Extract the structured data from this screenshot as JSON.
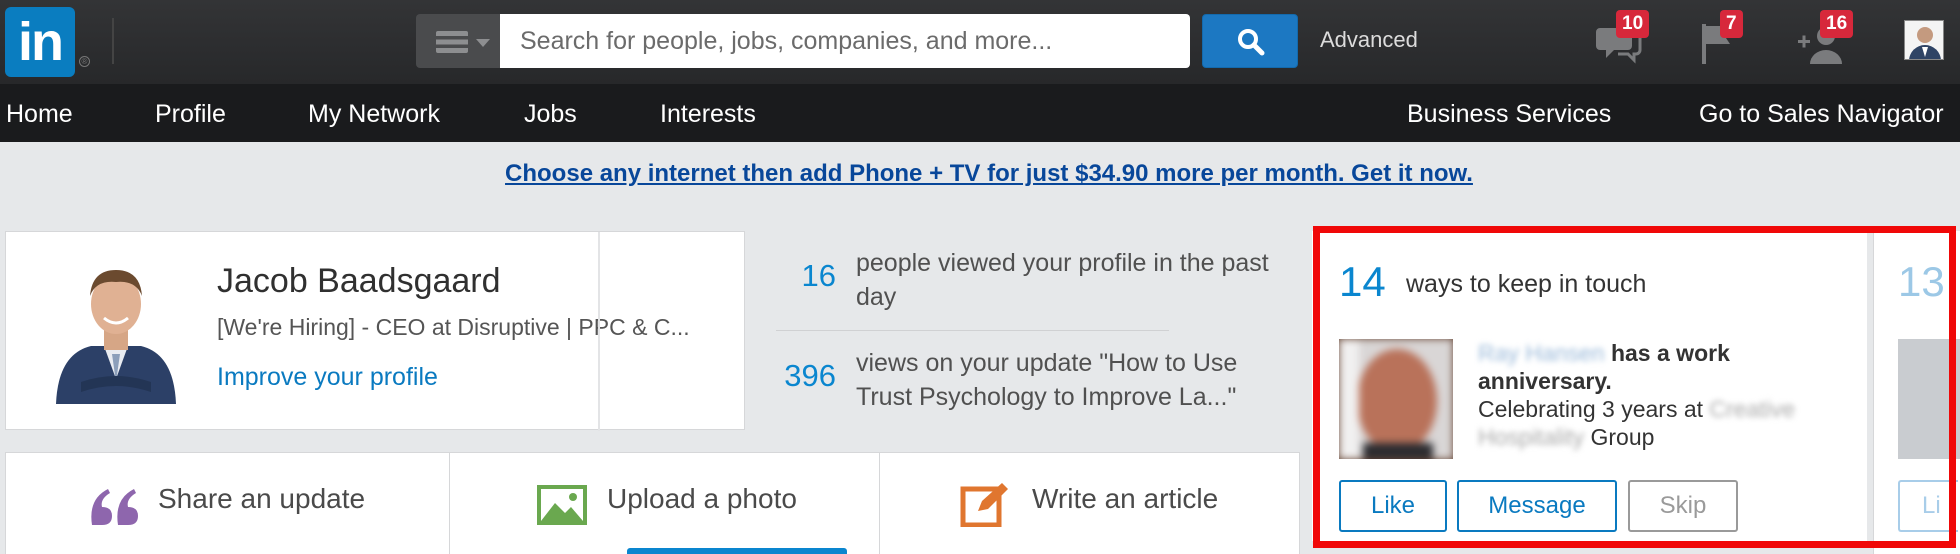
{
  "header": {
    "logo_text": "in",
    "logo_reg": "®",
    "search_placeholder": "Search for people, jobs, companies, and more...",
    "advanced_label": "Advanced",
    "messages_badge": "10",
    "notifications_badge": "7",
    "connections_badge": "16"
  },
  "nav": {
    "items": [
      "Home",
      "Profile",
      "My Network",
      "Jobs",
      "Interests"
    ],
    "business_services": "Business Services",
    "sales_navigator": "Go to Sales Navigator"
  },
  "ad": {
    "text": "Choose any internet then add Phone + TV for just $34.90 more per month. Get it now."
  },
  "profile": {
    "name": "Jacob Baadsgaard",
    "headline": "[We're Hiring] - CEO at Disruptive | PPC & C...",
    "improve_link": "Improve your profile",
    "stats": [
      {
        "count": "16",
        "text": "people viewed your profile in the past day"
      },
      {
        "count": "396",
        "text": "views on your update \"How to Use Trust Psychology to Improve La...\""
      }
    ]
  },
  "actions": {
    "share": "Share an update",
    "upload": "Upload a photo",
    "write": "Write an article"
  },
  "keep_in_touch": {
    "count": "14",
    "title": "ways to keep in touch",
    "blurred_name": "Ray Hansen",
    "event_text": "has a work anniversary.",
    "celebrating_prefix": "Celebrating 3 years at",
    "blurred_company": "Creative Hospitality",
    "company_suffix": "Group",
    "like": "Like",
    "message": "Message",
    "skip": "Skip"
  },
  "next_card": {
    "count": "13",
    "button": "Li"
  },
  "colors": {
    "brand_blue": "#0a7dc0",
    "badge_red": "#d7283b",
    "highlight_red": "#f00808"
  }
}
